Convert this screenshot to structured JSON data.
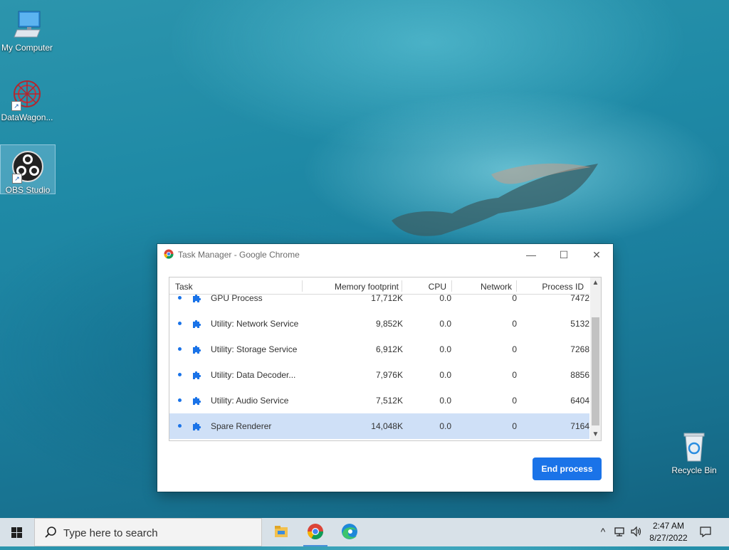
{
  "desktop": {
    "icons": [
      {
        "label": "My Computer",
        "icon": "computer-icon"
      },
      {
        "label": "DataWagon...",
        "icon": "datawagon-icon"
      },
      {
        "label": "OBS Studio",
        "icon": "obs-icon"
      },
      {
        "label": "Recycle Bin",
        "icon": "recycle-bin-icon"
      }
    ]
  },
  "window": {
    "title": "Task Manager - Google Chrome",
    "controls": {
      "minimize": "—",
      "maximize": "☐",
      "close": "✕"
    },
    "columns": [
      "Task",
      "Memory footprint",
      "CPU",
      "Network",
      "Process ID"
    ],
    "rows": [
      {
        "task": "GPU Process",
        "memory": "17,712K",
        "cpu": "0.0",
        "network": "0",
        "pid": "7472"
      },
      {
        "task": "Utility: Network Service",
        "memory": "9,852K",
        "cpu": "0.0",
        "network": "0",
        "pid": "5132"
      },
      {
        "task": "Utility: Storage Service",
        "memory": "6,912K",
        "cpu": "0.0",
        "network": "0",
        "pid": "7268"
      },
      {
        "task": "Utility: Data Decoder...",
        "memory": "7,976K",
        "cpu": "0.0",
        "network": "0",
        "pid": "8856"
      },
      {
        "task": "Utility: Audio Service",
        "memory": "7,512K",
        "cpu": "0.0",
        "network": "0",
        "pid": "6404"
      },
      {
        "task": "Spare Renderer",
        "memory": "14,048K",
        "cpu": "0.0",
        "network": "0",
        "pid": "7164",
        "selected": true
      }
    ],
    "end_process_label": "End process"
  },
  "taskbar": {
    "search_placeholder": "Type here to search",
    "apps": [
      "file-explorer-icon",
      "chrome-icon",
      "edge-icon"
    ],
    "time": "2:47 AM",
    "date": "8/27/2022"
  },
  "colors": {
    "accent": "#1a73e8",
    "selected_row": "#cfe0f7"
  }
}
